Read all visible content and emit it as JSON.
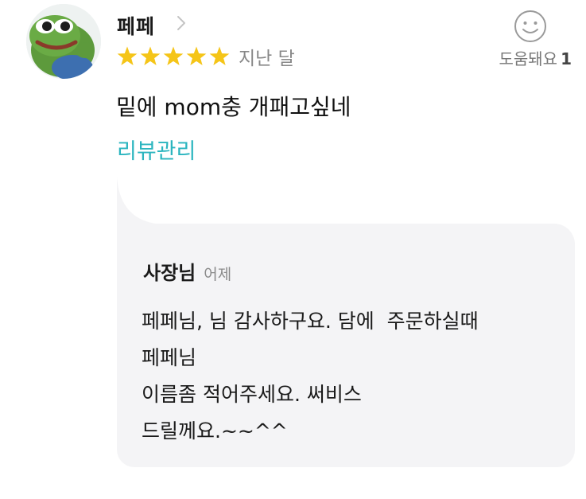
{
  "review": {
    "avatar_icon": "pepe-frog-avatar",
    "reviewer_name": "페페",
    "rating": 5,
    "rating_max": 5,
    "date": "지난 달",
    "helpful_label": "도움돼요",
    "helpful_count": "1",
    "text": "밑에 mom충 개패고싶네",
    "manage_link": "리뷰관리"
  },
  "reply": {
    "owner_name": "사장님",
    "date": "어제",
    "lines": [
      "페페님, 님 감사하구요. 담에  주문하실때",
      "페페님",
      "이름좀 적어주세요. 써비스",
      "드릴께요.~~^^"
    ]
  },
  "colors": {
    "star": "#f5c518",
    "link": "#2bb5bf",
    "reply_background": "#f4f4f6"
  }
}
